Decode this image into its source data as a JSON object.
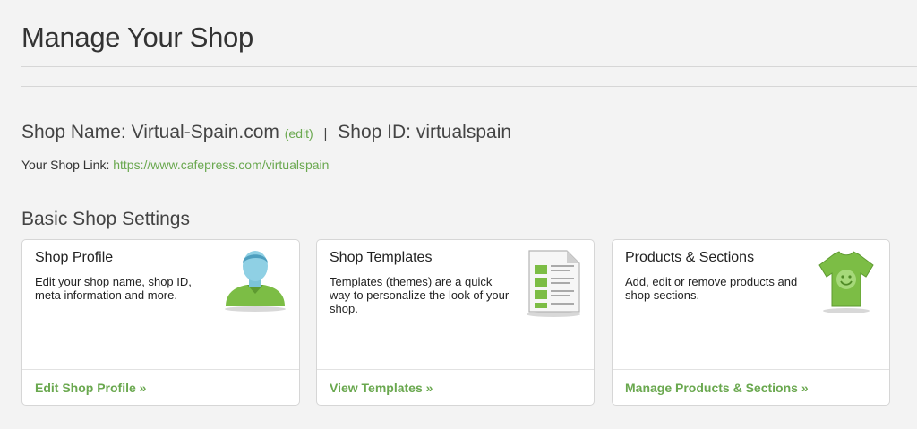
{
  "page": {
    "title": "Manage Your Shop"
  },
  "shop": {
    "name_label": "Shop Name: Virtual-Spain.com",
    "edit_label": "(edit)",
    "separator": "|",
    "id_label": "Shop ID: virtualspain",
    "link_label": "Your Shop Link:",
    "link_url": "https://www.cafepress.com/virtualspain"
  },
  "settings": {
    "section_title": "Basic Shop Settings",
    "cards": [
      {
        "title": "Shop Profile",
        "description": "Edit your shop name, shop ID, meta information and more.",
        "link": "Edit Shop Profile »",
        "icon": "user-profile-icon"
      },
      {
        "title": "Shop Templates",
        "description": "Templates (themes) are a quick way to personalize the look of your shop.",
        "link": "View Templates »",
        "icon": "document-template-icon"
      },
      {
        "title": "Products & Sections",
        "description": "Add, edit or remove products and shop sections.",
        "link": "Manage Products & Sections »",
        "icon": "tshirt-icon"
      }
    ]
  },
  "colors": {
    "accent": "#6aa84f",
    "card_border": "#d6d6d6",
    "background": "#f3f3f3"
  }
}
